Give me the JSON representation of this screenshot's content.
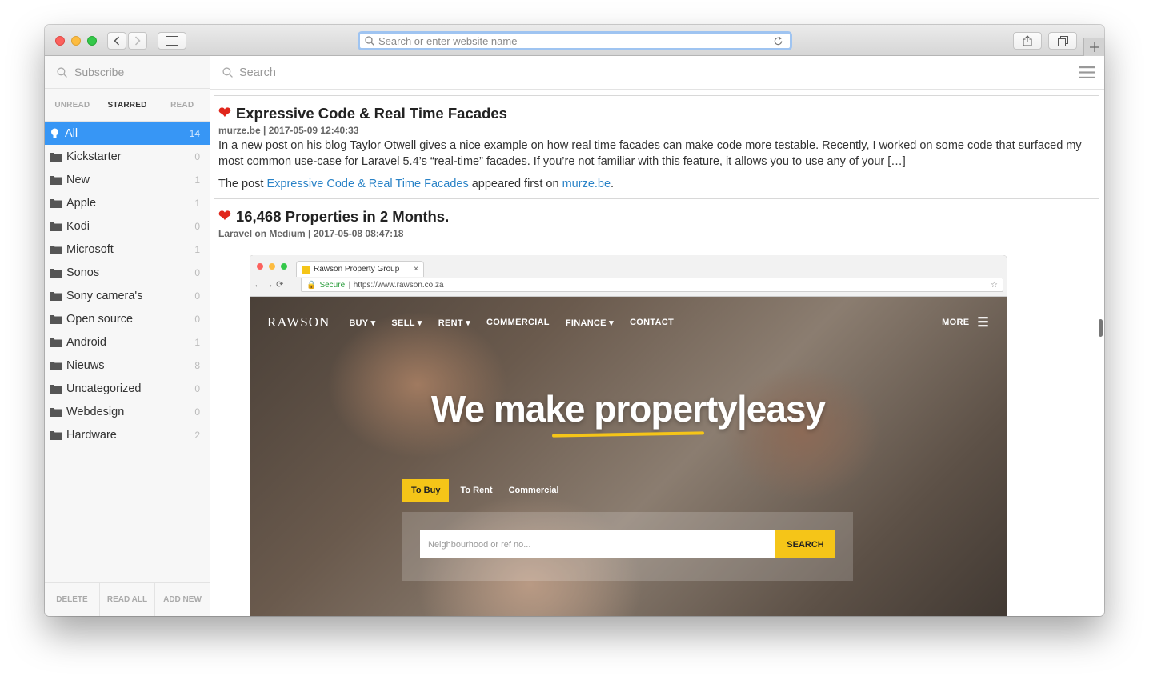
{
  "browser": {
    "address_placeholder": "Search or enter website name"
  },
  "sidebar": {
    "subscribe_placeholder": "Subscribe",
    "tabs": [
      "UNREAD",
      "STARRED",
      "READ"
    ],
    "folders": [
      {
        "name": "All",
        "count": "14"
      },
      {
        "name": "Kickstarter",
        "count": "0"
      },
      {
        "name": "New",
        "count": "1"
      },
      {
        "name": "Apple",
        "count": "1"
      },
      {
        "name": "Kodi",
        "count": "0"
      },
      {
        "name": "Microsoft",
        "count": "1"
      },
      {
        "name": "Sonos",
        "count": "0"
      },
      {
        "name": "Sony camera's",
        "count": "0"
      },
      {
        "name": "Open source",
        "count": "0"
      },
      {
        "name": "Android",
        "count": "1"
      },
      {
        "name": "Nieuws",
        "count": "8"
      },
      {
        "name": "Uncategorized",
        "count": "0"
      },
      {
        "name": "Webdesign",
        "count": "0"
      },
      {
        "name": "Hardware",
        "count": "2"
      }
    ],
    "footer": [
      "DELETE",
      "READ ALL",
      "ADD NEW"
    ]
  },
  "main": {
    "search_placeholder": "Search",
    "articles": [
      {
        "title": "Expressive Code & Real Time Facades",
        "meta": "murze.be | 2017-05-09 12:40:33",
        "body": "In a new post on his blog Taylor Otwell gives a nice example on how real time facades can make code more testable. Recently, I worked on some code that surfaced my most common use-case for Laravel 5.4’s “real-time” facades. If you’re not familiar with this feature, it allows you to use any of your […]",
        "post_prefix": "The post ",
        "post_link": "Expressive Code & Real Time Facades",
        "post_mid": " appeared first on ",
        "post_site": "murze.be",
        "post_end": "."
      },
      {
        "title": "16,468 Properties in 2 Months.",
        "meta": "Laravel on Medium | 2017-05-08 08:47:18"
      }
    ]
  },
  "screenshot": {
    "tab_title": "Rawson Property Group",
    "secure": "Secure",
    "url": "https://www.rawson.co.za",
    "logo": "RAWSON",
    "nav": [
      "BUY ▾",
      "SELL ▾",
      "RENT ▾",
      "COMMERCIAL",
      "FINANCE ▾",
      "CONTACT"
    ],
    "more": "MORE",
    "headline": "We make property|easy",
    "tabs": [
      "To Buy",
      "To Rent",
      "Commercial"
    ],
    "input_placeholder": "Neighbourhood or ref no...",
    "search_button": "SEARCH"
  },
  "colors": {
    "selected": "#3796f5",
    "link": "#2a83c7",
    "heart": "#e0261b",
    "rawson_yellow": "#f5c518"
  }
}
